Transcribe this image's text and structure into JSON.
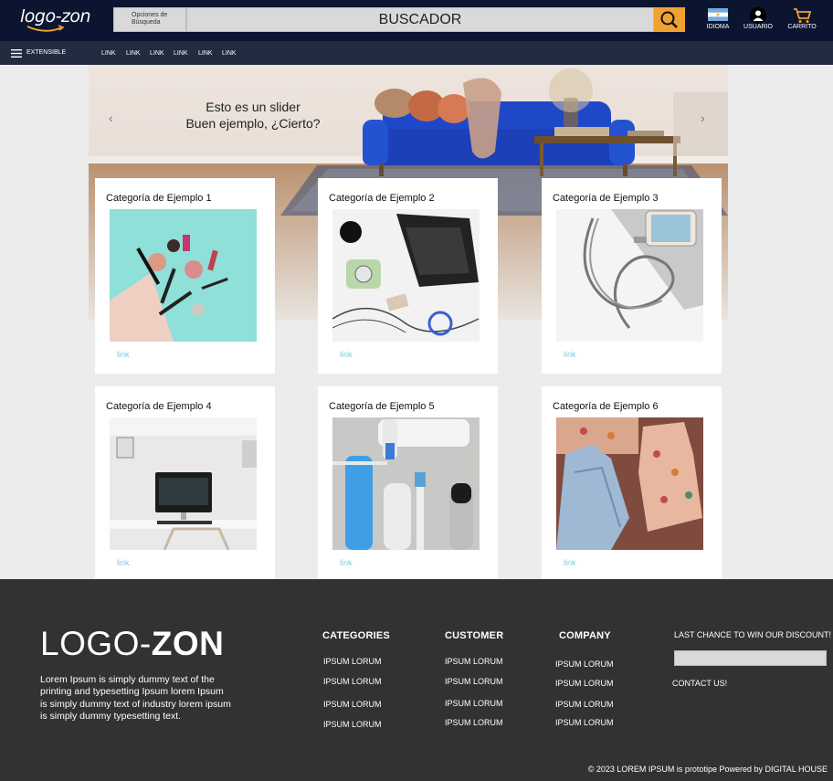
{
  "header": {
    "logo_text": "logo-zon",
    "search_options_label": "Opciones de Búsqueda",
    "search_placeholder": "BUSCADOR",
    "icons": [
      {
        "name": "flag-icon",
        "label": "IDIOMA"
      },
      {
        "name": "user-icon",
        "label": "USUARIO"
      },
      {
        "name": "cart-icon",
        "label": "CARRITO"
      }
    ],
    "accent": "#f0a230",
    "background": "#0b1530"
  },
  "nav": {
    "menu_label": "EXTENSIBLE",
    "links": [
      "LINK",
      "LINK",
      "LINK",
      "LINK",
      "LINK",
      "LINK"
    ]
  },
  "slider": {
    "line1": "Esto es un slider",
    "line2": "Buen ejemplo, ¿Cierto?",
    "prev": "‹",
    "next": "›"
  },
  "categories": [
    {
      "title": "Categoría de Ejemplo 1",
      "link": "link",
      "image": "makeup-products"
    },
    {
      "title": "Categoría de Ejemplo 2",
      "link": "link",
      "image": "laptop-camera-desk"
    },
    {
      "title": "Categoría de Ejemplo 3",
      "link": "link",
      "image": "phone-charging-cable"
    },
    {
      "title": "Categoría de Ejemplo 4",
      "link": "link",
      "image": "computer-desk"
    },
    {
      "title": "Categoría de Ejemplo 5",
      "link": "link",
      "image": "toiletries"
    },
    {
      "title": "Categoría de Ejemplo 6",
      "link": "link",
      "image": "floral-dresses"
    }
  ],
  "footer": {
    "logo_light": "LOGO-",
    "logo_bold": "ZON",
    "description": "Lorem Ipsum is simply dummy text of the printing and typesetting Ipsum lorem Ipsum is simply dummy text of industry lorem ipsum is simply dummy typesetting text.",
    "columns": [
      {
        "heading": "CATEGORIES",
        "items": [
          "IPSUM LORUM",
          "IPSUM LORUM",
          "IPSUM LORUM",
          "IPSUM LORUM"
        ]
      },
      {
        "heading": "CUSTOMER",
        "items": [
          "IPSUM LORUM",
          "IPSUM LORUM",
          "IPSUM LORUM",
          "IPSUM LORUM"
        ]
      },
      {
        "heading": "COMPANY",
        "items": [
          "IPSUM LORUM",
          "IPSUM LORUM",
          "IPSUM LORUM",
          "IPSUM LORUM"
        ]
      }
    ],
    "discount_title": "LAST CHANCE TO WIN OUR DISCOUNT!",
    "contact": "CONTACT US!",
    "copyright": "© 2023 LOREM IPSUM  is  prototipe Powered by  DIGITAL HOUSE"
  }
}
